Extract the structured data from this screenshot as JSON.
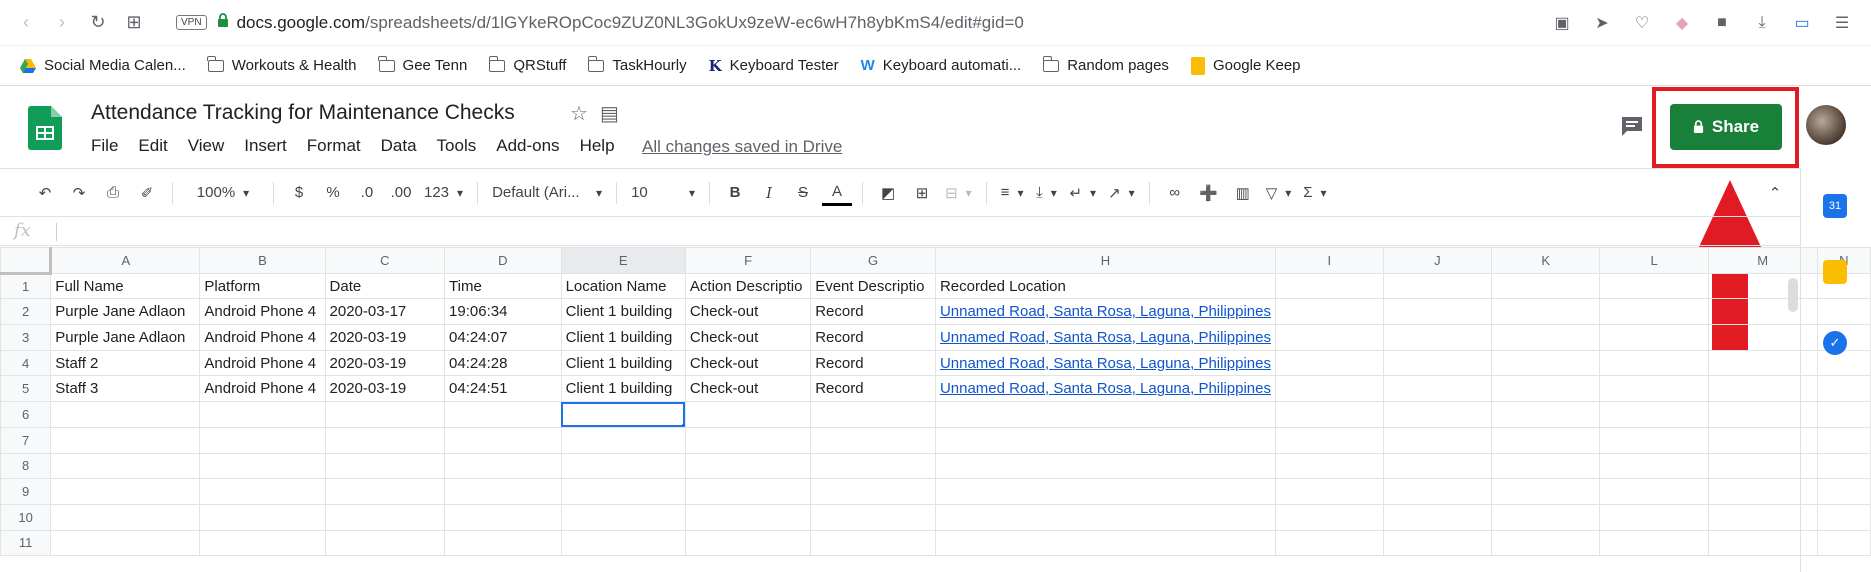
{
  "browser": {
    "vpn": "VPN",
    "url_host": "docs.google.com",
    "url_path": "/spreadsheets/d/1lGYkeROpCoc9ZUZ0NL3GokUx9zeW-ec6wH7h8ybKmS4/edit#gid=0"
  },
  "bookmarks": [
    {
      "label": "Social Media Calen...",
      "icon": "drive-icon"
    },
    {
      "label": "Workouts & Health",
      "icon": "folder-icon"
    },
    {
      "label": "Gee Tenn",
      "icon": "folder-icon"
    },
    {
      "label": "QRStuff",
      "icon": "folder-icon"
    },
    {
      "label": "TaskHourly",
      "icon": "folder-icon"
    },
    {
      "label": "Keyboard Tester",
      "icon": "k-icon"
    },
    {
      "label": "Keyboard automati...",
      "icon": "w-icon"
    },
    {
      "label": "Random pages",
      "icon": "folder-icon"
    },
    {
      "label": "Google Keep",
      "icon": "keep-icon"
    }
  ],
  "doc": {
    "title": "Attendance Tracking for Maintenance Checks",
    "menu": [
      "File",
      "Edit",
      "View",
      "Insert",
      "Format",
      "Data",
      "Tools",
      "Add-ons",
      "Help"
    ],
    "saved_status": "All changes saved in Drive",
    "share_label": "Share"
  },
  "toolbar": {
    "zoom": "100%",
    "currency": "$",
    "percent": "%",
    "dec_decrease": ".0",
    "dec_increase": ".00",
    "format_more": "123",
    "font": "Default (Ari...",
    "font_size": "10",
    "bold": "B",
    "italic": "I",
    "strike": "S",
    "text_color": "A"
  },
  "formula_bar": {
    "fx": "fx"
  },
  "columns": [
    "A",
    "B",
    "C",
    "D",
    "E",
    "F",
    "G",
    "H",
    "I",
    "J",
    "K",
    "L",
    "M",
    "N"
  ],
  "rows": [
    [
      "Full Name",
      "Platform",
      "Date",
      "Time",
      "Location Name",
      "Action Descriptio",
      "Event Descriptio",
      "Recorded Location"
    ],
    [
      "Purple Jane Adlaon",
      "Android Phone 4",
      "2020-03-17",
      "19:06:34",
      "Client 1 building",
      "Check-out",
      "Record",
      "Unnamed Road, Santa Rosa, Laguna, Philippines"
    ],
    [
      "Purple Jane Adlaon",
      "Android Phone 4",
      "2020-03-19",
      "04:24:07",
      "Client 1 building",
      "Check-out",
      "Record",
      "Unnamed Road, Santa Rosa, Laguna, Philippines"
    ],
    [
      "Staff 2",
      "Android Phone 4",
      "2020-03-19",
      "04:24:28",
      "Client 1 building",
      "Check-out",
      "Record",
      "Unnamed Road, Santa Rosa, Laguna, Philippines"
    ],
    [
      "Staff 3",
      "Android Phone 4",
      "2020-03-19",
      "04:24:51",
      "Client 1 building",
      "Check-out",
      "Record",
      "Unnamed Road, Santa Rosa, Laguna, Philippines"
    ]
  ],
  "row_numbers": [
    "1",
    "2",
    "3",
    "4",
    "5",
    "6",
    "7",
    "8",
    "9",
    "10",
    "11"
  ],
  "colors": {
    "share": "#188038",
    "highlight": "#e01b24",
    "link": "#1155cc"
  }
}
